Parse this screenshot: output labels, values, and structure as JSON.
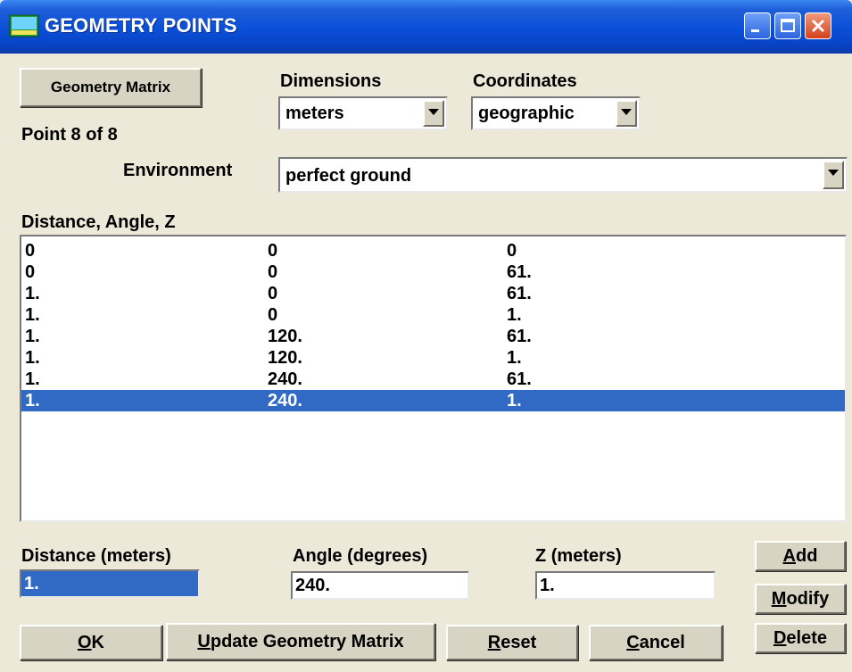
{
  "window": {
    "title": "GEOMETRY POINTS",
    "icon": "app-icon",
    "controls": [
      "minimize-icon",
      "maximize-icon",
      "close-icon"
    ]
  },
  "geometry_matrix_button": "Geometry Matrix",
  "point_label": "Point  8 of 8",
  "dimensions": {
    "label": "Dimensions",
    "value": "meters"
  },
  "coordinates": {
    "label": "Coordinates",
    "value": "geographic"
  },
  "environment": {
    "label": "Environment",
    "value": "perfect ground"
  },
  "list": {
    "header": "Distance,  Angle,  Z",
    "rows": [
      [
        "0",
        "0",
        "0"
      ],
      [
        "0",
        "0",
        "61."
      ],
      [
        "1.",
        "0",
        "61."
      ],
      [
        "1.",
        "0",
        "1."
      ],
      [
        "1.",
        "120.",
        "61."
      ],
      [
        "1.",
        "120.",
        "1."
      ],
      [
        "1.",
        "240.",
        "61."
      ],
      [
        "1.",
        "240.",
        "1."
      ]
    ],
    "selected_index": 7
  },
  "inputs": {
    "distance": {
      "label": "Distance (meters)",
      "value": "1."
    },
    "angle": {
      "label": "Angle (degrees)",
      "value": "240."
    },
    "z": {
      "label": "Z (meters)",
      "value": "1."
    }
  },
  "buttons": {
    "add_hot": "A",
    "add_rest": "dd",
    "modify_hot": "M",
    "modify_rest": "odify",
    "delete_hot": "D",
    "delete_rest": "elete",
    "ok_hot": "O",
    "ok_rest": "K",
    "update_hot": "U",
    "update_rest": "pdate Geometry Matrix",
    "reset_hot": "R",
    "reset_rest": "eset",
    "cancel_hot": "C",
    "cancel_rest": "ancel"
  },
  "colors": {
    "titlebar": "#0a4fd8",
    "selection": "#316ac5",
    "dialog": "#ece9d8"
  }
}
